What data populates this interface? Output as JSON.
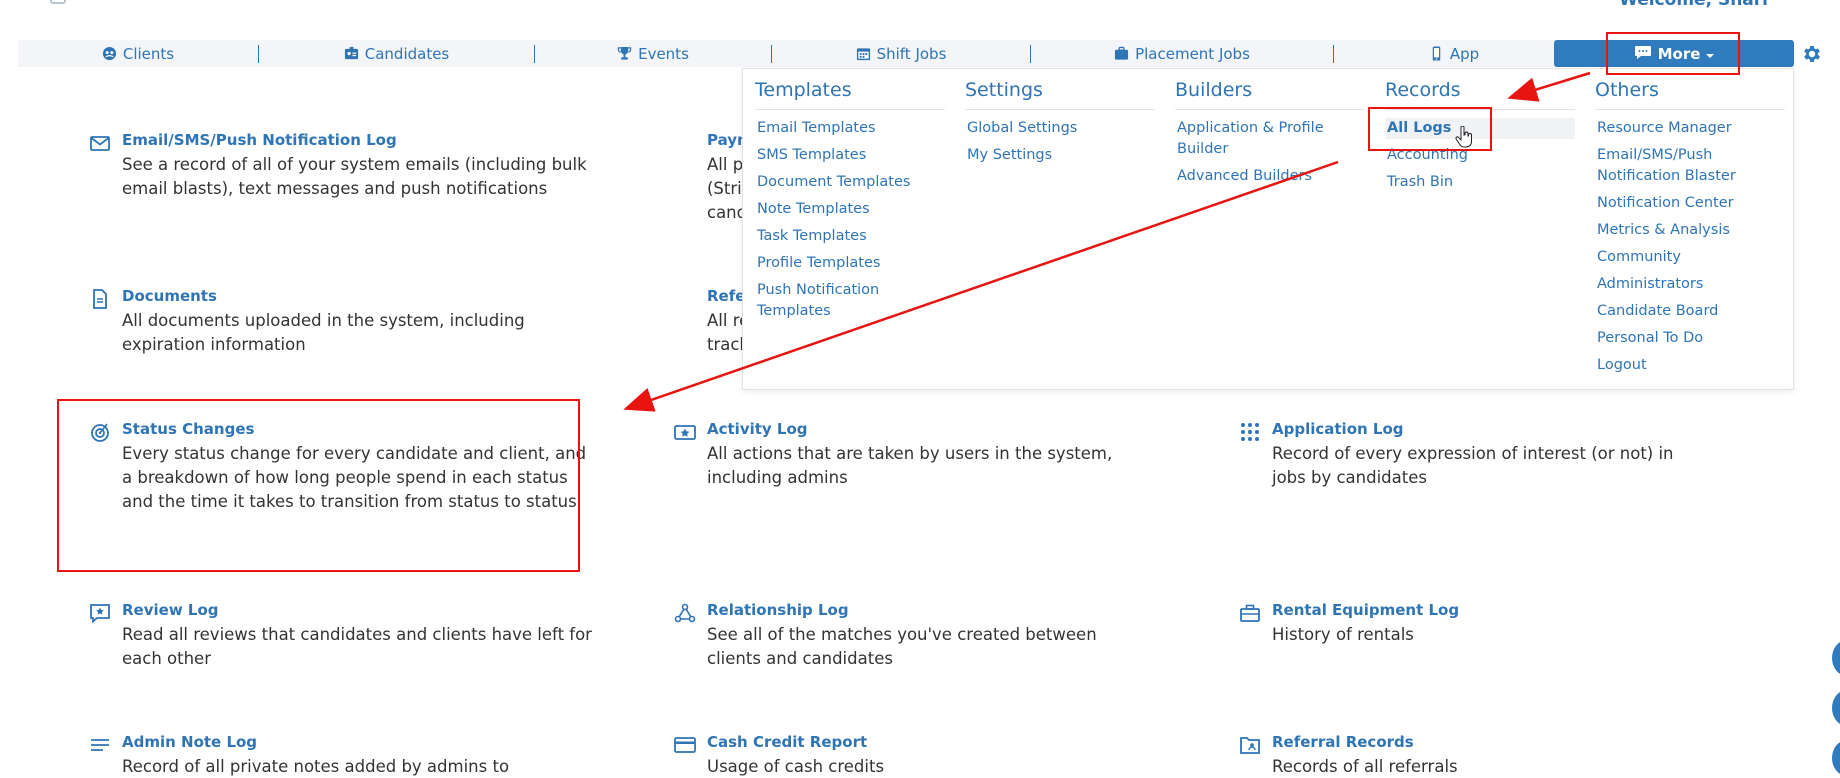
{
  "header": {
    "welcome": "Welcome, Shari"
  },
  "nav": {
    "items": [
      {
        "label": "Clients",
        "icon": "clients-icon"
      },
      {
        "label": "Candidates",
        "icon": "candidates-icon"
      },
      {
        "label": "Events",
        "icon": "trophy-icon"
      },
      {
        "label": "Shift Jobs",
        "icon": "calendar-icon"
      },
      {
        "label": "Placement Jobs",
        "icon": "briefcase-icon"
      },
      {
        "label": "App",
        "icon": "mobile-icon"
      }
    ],
    "more_label": "More"
  },
  "dropdown": {
    "templates": {
      "title": "Templates",
      "links": [
        "Email Templates",
        "SMS Templates",
        "Document Templates",
        "Note Templates",
        "Task Templates",
        "Profile Templates",
        "Push Notification Templates"
      ]
    },
    "settings": {
      "title": "Settings",
      "links": [
        "Global Settings",
        "My Settings"
      ]
    },
    "builders": {
      "title": "Builders",
      "links": [
        "Application & Profile Builder",
        "Advanced Builders"
      ]
    },
    "records": {
      "title": "Records",
      "links": [
        "All Logs",
        "Accounting",
        "Trash Bin"
      ],
      "active": "All Logs"
    },
    "others": {
      "title": "Others",
      "links": [
        "Resource Manager",
        "Email/SMS/Push Notification Blaster",
        "Notification Center",
        "Metrics & Analysis",
        "Community",
        "Administrators",
        "Candidate Board",
        "Personal To Do",
        "Logout"
      ]
    }
  },
  "logs": [
    {
      "title": "Email/SMS/Push Notification Log",
      "desc": "See a record of all of your system emails (including bulk email blasts), text messages and push notifications",
      "icon": "envelope-icon"
    },
    {
      "title": "Paym",
      "desc": "All po\n(Strip\ncand",
      "icon": "money-icon"
    },
    {
      "title": "Documents",
      "desc": "All documents uploaded in the system, including expiration information",
      "icon": "document-icon"
    },
    {
      "title": "Refer",
      "desc": "All re\ntrack",
      "icon": "bookmark-icon"
    },
    {
      "title": "Status Changes",
      "desc": "Every status change for every candidate and client, and a breakdown of how long people spend in each status and the time it takes to transition from status to status",
      "icon": "target-icon"
    },
    {
      "title": "Activity Log",
      "desc": "All actions that are taken by users in the system, including admins",
      "icon": "star-ticket-icon"
    },
    {
      "title": "Application Log",
      "desc": "Record of every expression of interest (or not) in jobs by candidates",
      "icon": "grid-dots-icon"
    },
    {
      "title": "Review Log",
      "desc": "Read all reviews that candidates and clients have left for each other",
      "icon": "star-comment-icon"
    },
    {
      "title": "Relationship Log",
      "desc": "See all of the matches you've created between clients and candidates",
      "icon": "network-icon"
    },
    {
      "title": "Rental Equipment Log",
      "desc": "History of rentals",
      "icon": "toolbox-icon"
    },
    {
      "title": "Admin Note Log",
      "desc": "Record of all private notes added by admins to",
      "icon": "lines-icon"
    },
    {
      "title": "Cash Credit Report",
      "desc": "Usage of cash credits",
      "icon": "credit-card-icon"
    },
    {
      "title": "Referral Records",
      "desc": "Records of all referrals",
      "icon": "folder-user-icon"
    }
  ],
  "colors": {
    "accent": "#2f74b5",
    "button": "#2f7bbd",
    "annotation": "#e8140f"
  }
}
